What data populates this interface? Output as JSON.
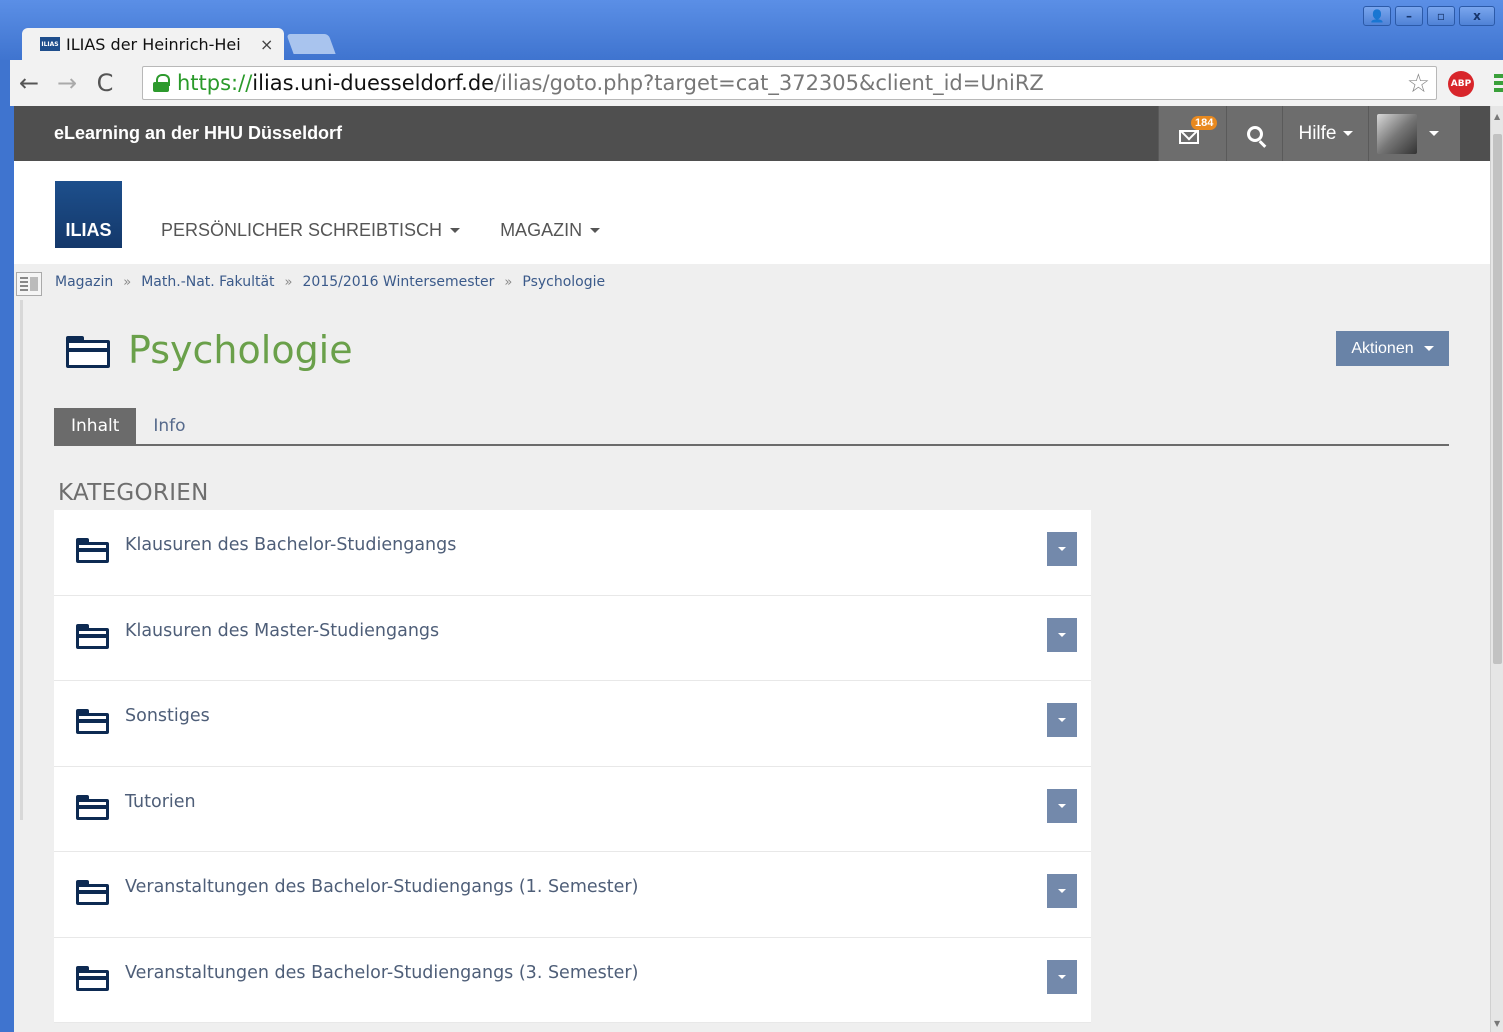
{
  "browser": {
    "tab_title": "ILIAS der Heinrich-Hei",
    "tab_close": "×",
    "favicon_text": "ILIAS",
    "url": {
      "scheme": "https://",
      "host": "ilias.uni-duesseldorf.de",
      "path": "/ilias/goto.php?target=cat_372305&client_id=UniRZ"
    },
    "window_buttons": [
      "👤",
      "–",
      "▫",
      "x"
    ],
    "abp_label": "ABP"
  },
  "topbar": {
    "title": "eLearning an der HHU Düsseldorf",
    "mail_count": "184",
    "help_label": "Hilfe"
  },
  "header": {
    "logo_text": "ILIAS",
    "nav": [
      {
        "label": "PERSÖNLICHER SCHREIBTISCH"
      },
      {
        "label": "MAGAZIN"
      }
    ]
  },
  "breadcrumb": {
    "items": [
      "Magazin",
      "Math.-Nat. Fakultät",
      "2015/2016 Wintersemester",
      "Psychologie"
    ],
    "separator": "»"
  },
  "page": {
    "title": "Psychologie",
    "actions_label": "Aktionen",
    "tabs": [
      {
        "label": "Inhalt",
        "active": true
      },
      {
        "label": "Info",
        "active": false
      }
    ]
  },
  "section": {
    "title": "KATEGORIEN",
    "items": [
      {
        "label": "Klausuren des Bachelor-Studiengangs"
      },
      {
        "label": "Klausuren des Master-Studiengangs"
      },
      {
        "label": "Sonstiges"
      },
      {
        "label": "Tutorien"
      },
      {
        "label": "Veranstaltungen des Bachelor-Studiengangs (1. Semester)"
      },
      {
        "label": "Veranstaltungen des Bachelor-Studiengangs (3. Semester)"
      }
    ]
  },
  "colors": {
    "title_green": "#6aa04a",
    "topbar_bg": "#4f4f4f",
    "button_blue": "#6983a7",
    "link_blue": "#3b5a8a"
  }
}
